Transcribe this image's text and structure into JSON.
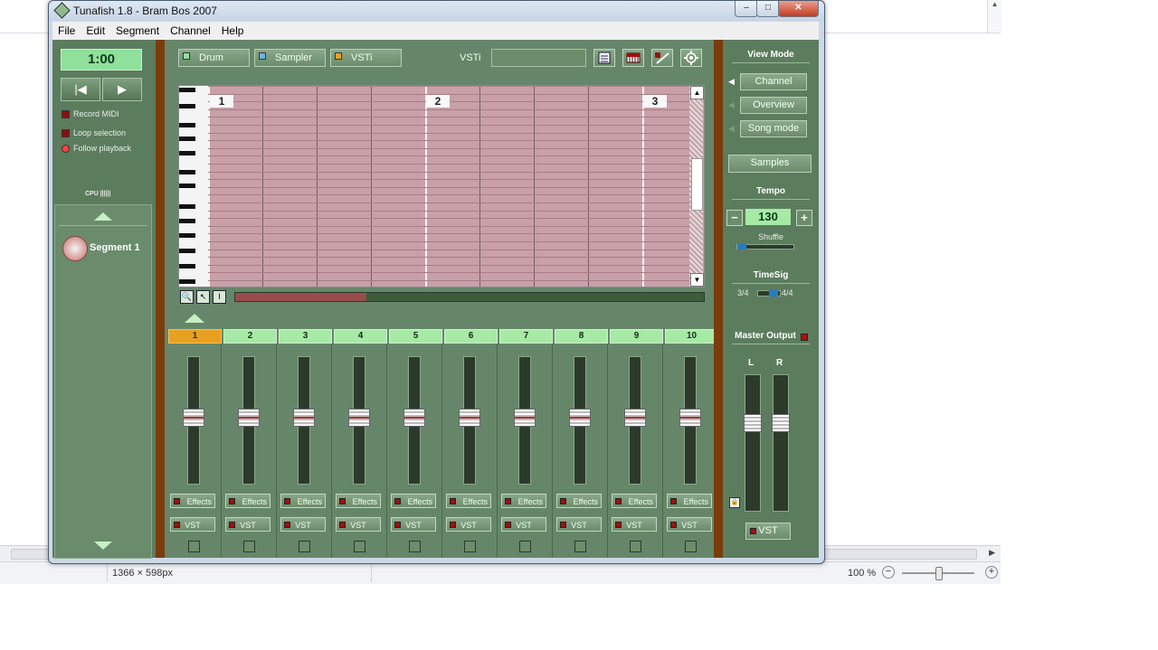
{
  "viewer": {
    "dimensions": "1366 × 598px",
    "zoom": "100 %",
    "zoom_out": "−",
    "zoom_in": "+"
  },
  "window": {
    "title": "Tunafish 1.8  -  Bram Bos 2007",
    "min": "–",
    "max": "□",
    "close": "✕"
  },
  "menu": [
    "File",
    "Edit",
    "Segment",
    "Channel",
    "Help"
  ],
  "transport": {
    "time": "1:00",
    "rewind": "|◀",
    "play": "▶",
    "record_midi": "Record MIDI",
    "loop_selection": "Loop selection",
    "follow_playback": "Follow playback",
    "cpu": "CPU ||||||"
  },
  "segments": {
    "items": [
      "Segment 1"
    ]
  },
  "instrument_tabs": [
    {
      "label": "Drum",
      "led_color": "#8fe09a"
    },
    {
      "label": "Sampler",
      "led_color": "#6ab4e0"
    },
    {
      "label": "VSTi",
      "led_color": "#e8a020"
    }
  ],
  "vsti_label": "VSTi",
  "vsti_plugin": "",
  "toolbar_icons": [
    "list-icon",
    "keyboard-icon",
    "automation-icon",
    "gear-icon"
  ],
  "piano_roll": {
    "bar_numbers": [
      "1",
      "2",
      "3"
    ],
    "scroll_up": "▲",
    "scroll_down": "▼",
    "scroll_progress": 0.28
  },
  "tools": {
    "zoom": "🔍",
    "pointer": "↖",
    "text": "I"
  },
  "mixer": {
    "selected_channel": "1",
    "fader_level": 0.5,
    "channels": [
      {
        "num": "1",
        "effects": "Effects",
        "vst": "VST"
      },
      {
        "num": "2",
        "effects": "Effects",
        "vst": "VST"
      },
      {
        "num": "3",
        "effects": "Effects",
        "vst": "VST"
      },
      {
        "num": "4",
        "effects": "Effects",
        "vst": "VST"
      },
      {
        "num": "5",
        "effects": "Effects",
        "vst": "VST"
      },
      {
        "num": "6",
        "effects": "Effects",
        "vst": "VST"
      },
      {
        "num": "7",
        "effects": "Effects",
        "vst": "VST"
      },
      {
        "num": "8",
        "effects": "Effects",
        "vst": "VST"
      },
      {
        "num": "9",
        "effects": "Effects",
        "vst": "VST"
      },
      {
        "num": "10",
        "effects": "Effects",
        "vst": "VST"
      }
    ]
  },
  "right_panel": {
    "view_mode_title": "View Mode",
    "view_modes": [
      "Channel",
      "Overview",
      "Song mode"
    ],
    "samples": "Samples",
    "tempo_title": "Tempo",
    "tempo_minus": "−",
    "tempo_value": "130",
    "tempo_plus": "+",
    "shuffle": "Shuffle",
    "shuffle_value": 0,
    "timesig_title": "TimeSig",
    "timesig_left": "3/4",
    "timesig_right": "4/4",
    "master_output": "Master Output",
    "left": "L",
    "right": "R",
    "master_vst": "VST"
  }
}
